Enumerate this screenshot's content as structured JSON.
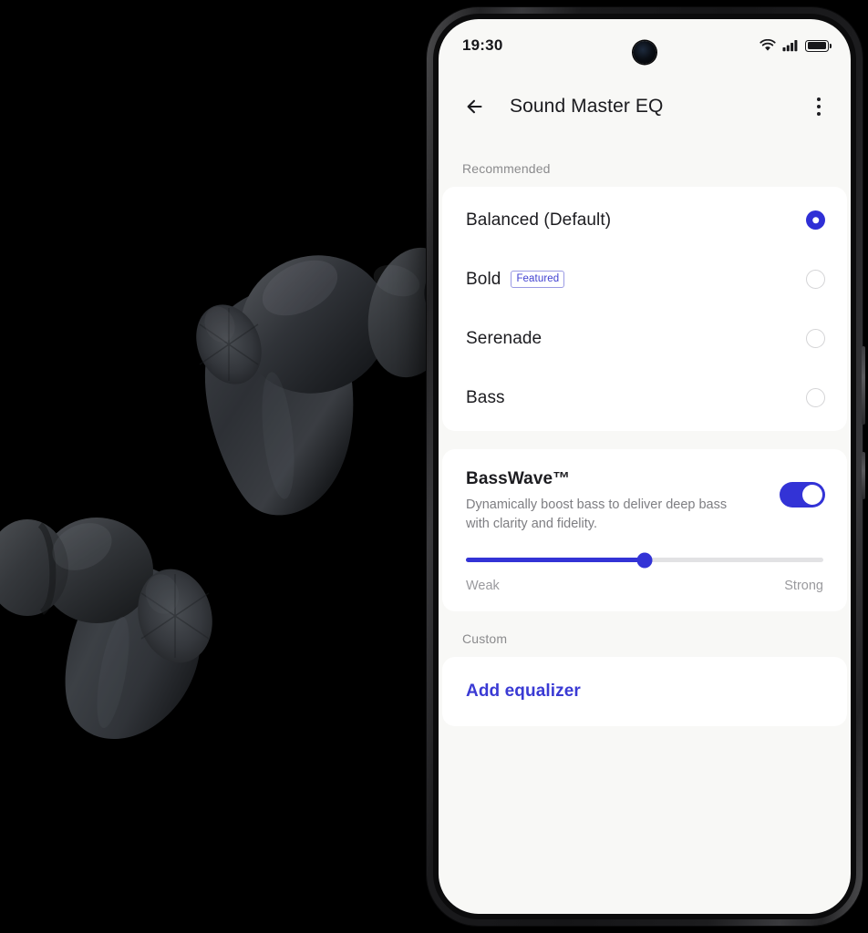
{
  "status_bar": {
    "time": "19:30",
    "wifi_icon": "wifi-icon",
    "signal_icon": "cellular-signal-icon",
    "battery_icon": "battery-full-icon"
  },
  "app_bar": {
    "back_icon": "back-arrow-icon",
    "title": "Sound Master EQ",
    "overflow_icon": "more-vertical-icon"
  },
  "sections": {
    "recommended_label": "Recommended",
    "custom_label": "Custom"
  },
  "eq_presets": [
    {
      "name": "Balanced (Default)",
      "badge": "",
      "selected": true
    },
    {
      "name": "Bold",
      "badge": "Featured",
      "selected": false
    },
    {
      "name": "Serenade",
      "badge": "",
      "selected": false
    },
    {
      "name": "Bass",
      "badge": "",
      "selected": false
    }
  ],
  "basswave": {
    "title": "BassWave™",
    "description": "Dynamically boost bass to deliver deep bass with clarity and fidelity.",
    "enabled": true,
    "slider_percent": 50,
    "scale_min_label": "Weak",
    "scale_max_label": "Strong"
  },
  "custom": {
    "add_equalizer_label": "Add equalizer"
  },
  "colors": {
    "accent": "#3333d6",
    "radio_selected": "#2f2fd6",
    "badge_text": "#3f3fd0",
    "badge_border": "#9a9ae4",
    "screen_background": "#f8f8f6",
    "card_background": "#ffffff",
    "primary_text": "#1c1c20",
    "secondary_text": "#7e7e82"
  }
}
